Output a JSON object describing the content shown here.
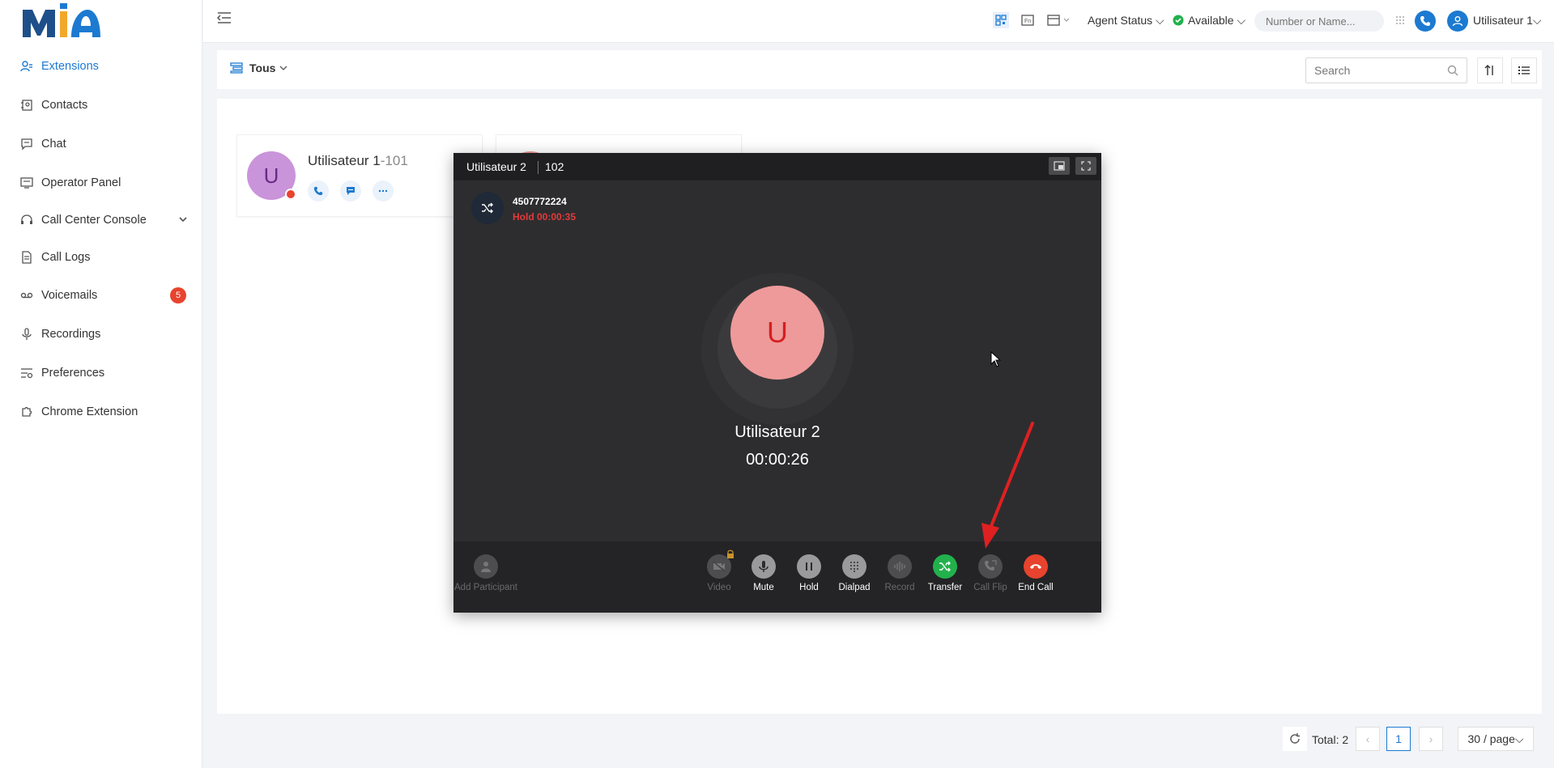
{
  "sidebar": {
    "items": [
      {
        "label": "Extensions",
        "icon": "extensions-icon"
      },
      {
        "label": "Contacts",
        "icon": "contacts-icon"
      },
      {
        "label": "Chat",
        "icon": "chat-icon"
      },
      {
        "label": "Operator Panel",
        "icon": "operator-panel-icon"
      },
      {
        "label": "Call Center Console",
        "icon": "headset-icon"
      },
      {
        "label": "Call Logs",
        "icon": "call-logs-icon"
      },
      {
        "label": "Voicemails",
        "icon": "voicemail-icon",
        "badge": "5"
      },
      {
        "label": "Recordings",
        "icon": "microphone-icon"
      },
      {
        "label": "Preferences",
        "icon": "preferences-icon"
      },
      {
        "label": "Chrome Extension",
        "icon": "puzzle-icon"
      }
    ]
  },
  "header": {
    "agent_status": "Agent Status",
    "availability": "Available",
    "dial_placeholder": "Number or Name...",
    "user": "Utilisateur 1"
  },
  "toolbar": {
    "filter": "Tous",
    "search_placeholder": "Search"
  },
  "cards": [
    {
      "name": "Utilisateur 1",
      "ext": "-101",
      "initial": "U"
    }
  ],
  "pagination": {
    "total": "Total: 2",
    "current_page": "1",
    "page_size": "30 / page"
  },
  "call": {
    "title": "Utilisateur 2",
    "ext": "102",
    "held_number": "4507772224",
    "held_status": "Hold 00:00:35",
    "avatar_initial": "U",
    "name": "Utilisateur 2",
    "timer": "00:00:26",
    "controls": {
      "add_participant": "Add Participant",
      "video": "Video",
      "mute": "Mute",
      "hold": "Hold",
      "dialpad": "Dialpad",
      "record": "Record",
      "transfer": "Transfer",
      "call_flip": "Call Flip",
      "end_call": "End Call"
    }
  },
  "colors": {
    "accent": "#1c7ad1",
    "badge": "#e8432e",
    "transfer": "#22b14c",
    "end_call": "#e8432e",
    "hold_text": "#e23b3b"
  }
}
